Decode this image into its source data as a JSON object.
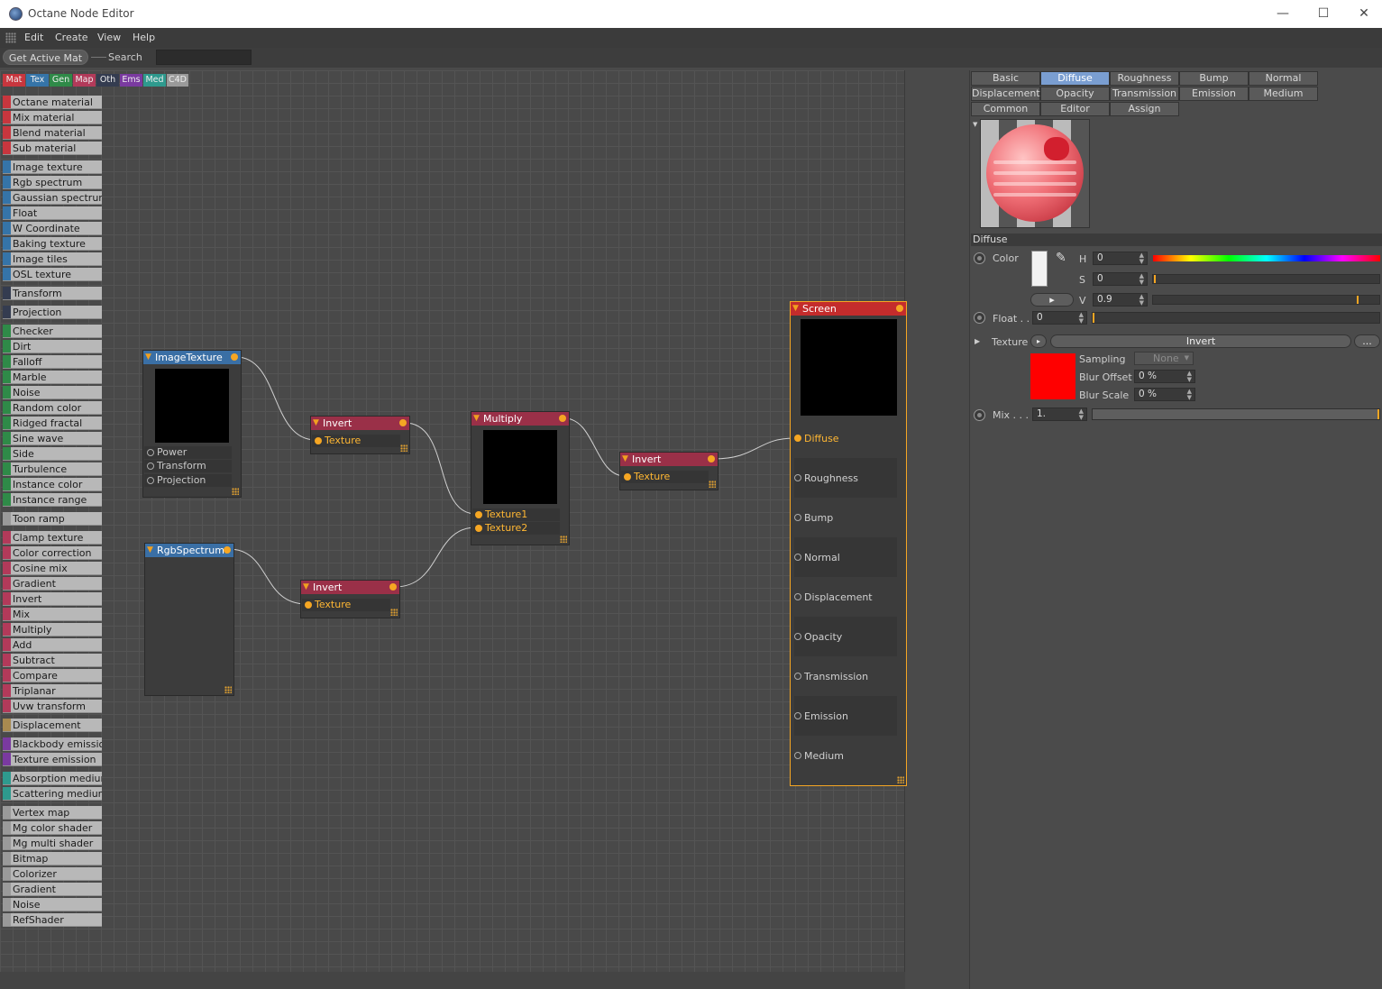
{
  "window": {
    "title": "Octane Node Editor",
    "minimize": "—",
    "maximize": "☐",
    "close": "✕"
  },
  "menu": [
    "Edit",
    "Create",
    "View",
    "Help"
  ],
  "toolbar": {
    "get_active_mat": "Get Active Mat",
    "search_label": "Search",
    "search_value": ""
  },
  "categories": [
    {
      "label": "Mat",
      "color": "#c8363e"
    },
    {
      "label": "Tex",
      "color": "#3574a8"
    },
    {
      "label": "Gen",
      "color": "#2f8a48"
    },
    {
      "label": "Map",
      "color": "#b23a5a"
    },
    {
      "label": "Oth",
      "color": "#343c50"
    },
    {
      "label": "Ems",
      "color": "#7a3aa0"
    },
    {
      "label": "Med",
      "color": "#2e9a8e"
    },
    {
      "label": "C4D",
      "color": "#9a9a9a"
    }
  ],
  "node_list": [
    {
      "label": "Octane material",
      "color": "#c8363e"
    },
    {
      "label": "Mix material",
      "color": "#c8363e"
    },
    {
      "label": "Blend material",
      "color": "#c8363e"
    },
    {
      "label": "Sub material",
      "color": "#c8363e"
    },
    {
      "label": "Image texture",
      "color": "#3574a8"
    },
    {
      "label": "Rgb spectrum",
      "color": "#3574a8"
    },
    {
      "label": "Gaussian spectrum",
      "color": "#3574a8"
    },
    {
      "label": "Float",
      "color": "#3574a8"
    },
    {
      "label": "W Coordinate",
      "color": "#3574a8"
    },
    {
      "label": "Baking texture",
      "color": "#3574a8"
    },
    {
      "label": "Image tiles",
      "color": "#3574a8"
    },
    {
      "label": "OSL texture",
      "color": "#3574a8"
    },
    {
      "label": "Transform",
      "color": "#343c50"
    },
    {
      "label": "Projection",
      "color": "#343c50"
    },
    {
      "label": "Checker",
      "color": "#2f8a48"
    },
    {
      "label": "Dirt",
      "color": "#2f8a48"
    },
    {
      "label": "Falloff",
      "color": "#2f8a48"
    },
    {
      "label": "Marble",
      "color": "#2f8a48"
    },
    {
      "label": "Noise",
      "color": "#2f8a48"
    },
    {
      "label": "Random color",
      "color": "#2f8a48"
    },
    {
      "label": "Ridged fractal",
      "color": "#2f8a48"
    },
    {
      "label": "Sine wave",
      "color": "#2f8a48"
    },
    {
      "label": "Side",
      "color": "#2f8a48"
    },
    {
      "label": "Turbulence",
      "color": "#2f8a48"
    },
    {
      "label": "Instance color",
      "color": "#2f8a48"
    },
    {
      "label": "Instance range",
      "color": "#2f8a48"
    },
    {
      "label": "Toon ramp",
      "color": "#9a9a9a"
    },
    {
      "label": "Clamp texture",
      "color": "#b23a5a"
    },
    {
      "label": "Color correction",
      "color": "#b23a5a"
    },
    {
      "label": "Cosine mix",
      "color": "#b23a5a"
    },
    {
      "label": "Gradient",
      "color": "#b23a5a"
    },
    {
      "label": "Invert",
      "color": "#b23a5a"
    },
    {
      "label": "Mix",
      "color": "#b23a5a"
    },
    {
      "label": "Multiply",
      "color": "#b23a5a"
    },
    {
      "label": "Add",
      "color": "#b23a5a"
    },
    {
      "label": "Subtract",
      "color": "#b23a5a"
    },
    {
      "label": "Compare",
      "color": "#b23a5a"
    },
    {
      "label": "Triplanar",
      "color": "#b23a5a"
    },
    {
      "label": "Uvw transform",
      "color": "#b23a5a"
    },
    {
      "label": "Displacement",
      "color": "#a88a50"
    },
    {
      "label": "Blackbody emission",
      "color": "#7a3aa0"
    },
    {
      "label": "Texture emission",
      "color": "#7a3aa0"
    },
    {
      "label": "Absorption medium",
      "color": "#2e9a8e"
    },
    {
      "label": "Scattering medium",
      "color": "#2e9a8e"
    },
    {
      "label": "Vertex map",
      "color": "#9a9a9a"
    },
    {
      "label": "Mg color shader",
      "color": "#9a9a9a"
    },
    {
      "label": "Mg multi shader",
      "color": "#9a9a9a"
    },
    {
      "label": "Bitmap",
      "color": "#9a9a9a"
    },
    {
      "label": "Colorizer",
      "color": "#9a9a9a"
    },
    {
      "label": "Gradient",
      "color": "#9a9a9a"
    },
    {
      "label": "Noise",
      "color": "#9a9a9a"
    },
    {
      "label": "RefShader",
      "color": "#9a9a9a"
    }
  ],
  "nodes": {
    "image_texture": {
      "title": "ImageTexture",
      "color": "#3a6fa5",
      "ports": [
        "Power",
        "Transform",
        "Projection"
      ]
    },
    "rgb_spectrum": {
      "title": "RgbSpectrum",
      "color": "#3a6fa5"
    },
    "invert_a": {
      "title": "Invert",
      "color": "#9a3048",
      "port": "Texture"
    },
    "invert_b": {
      "title": "Invert",
      "color": "#9a3048",
      "port": "Texture"
    },
    "invert_c": {
      "title": "Invert",
      "color": "#9a3048",
      "port": "Texture"
    },
    "multiply": {
      "title": "Multiply",
      "color": "#9a3048",
      "ports": [
        "Texture1",
        "Texture2"
      ]
    },
    "screen": {
      "title": "Screen",
      "color": "#c42c2c",
      "ports": [
        "Diffuse",
        "Roughness",
        "Bump",
        "Normal",
        "Displacement",
        "Opacity",
        "Transmission",
        "Emission",
        "Medium"
      ]
    }
  },
  "panel": {
    "tabs_row1": [
      "Basic",
      "Diffuse",
      "Roughness",
      "Bump",
      "Normal"
    ],
    "tabs_row2": [
      "Displacement",
      "Opacity",
      "Transmission",
      "Emission",
      "Medium"
    ],
    "tabs_row3": [
      "Common",
      "Editor",
      "Assign"
    ],
    "active_tab": "Diffuse",
    "section_title": "Diffuse",
    "color_label": "Color",
    "color_swatch": "#f2f2f2",
    "h_label": "H",
    "h_value": "0",
    "s_label": "S",
    "s_value": "0",
    "v_label": "V",
    "v_value": "0.9",
    "float_label": "Float . .",
    "float_value": "0",
    "texture_label": "Texture",
    "texture_value": "Invert",
    "texture_more": "...",
    "texture_swatch": "#ff0000",
    "sampling_label": "Sampling",
    "sampling_value": "None",
    "blur_offset_label": "Blur Offset",
    "blur_offset_value": "0 %",
    "blur_scale_label": "Blur Scale",
    "blur_scale_value": "0 %",
    "mix_label": "Mix . . .",
    "mix_value": "1."
  }
}
